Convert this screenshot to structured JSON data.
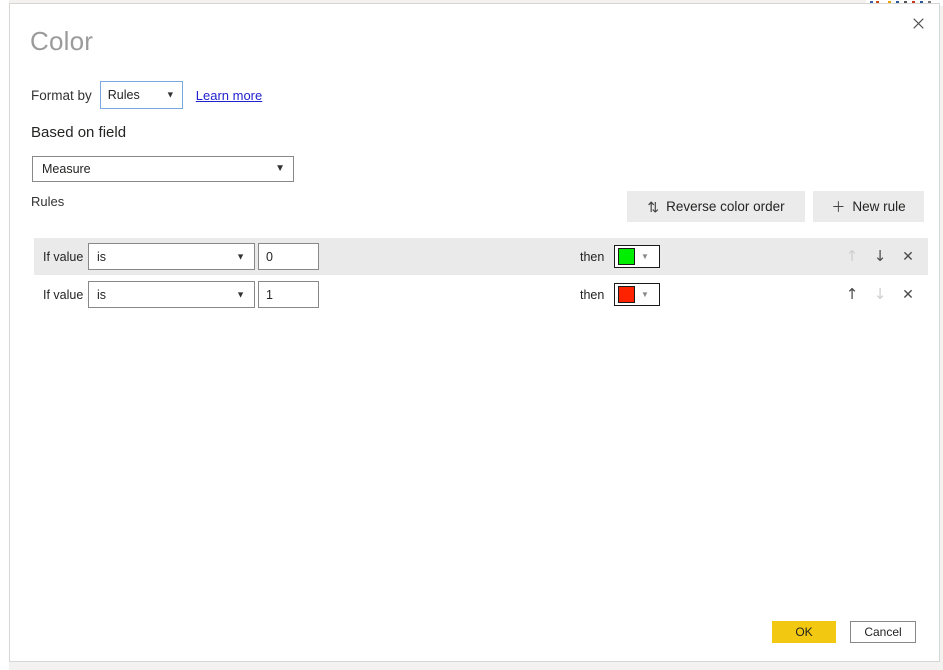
{
  "dialog": {
    "title": "Color",
    "close_icon": "close-icon"
  },
  "format_by": {
    "label": "Format by",
    "value": "Rules",
    "caret_icon": "chevron-down-icon",
    "learn_more": "Learn more"
  },
  "based_on_field": {
    "label": "Based on field",
    "value": "Measure",
    "caret_icon": "chevron-down-icon"
  },
  "rules_section": {
    "label": "Rules",
    "reverse_color_order": {
      "label": "Reverse color order",
      "icon": "sort-arrows-icon",
      "glyph": "⇅"
    },
    "new_rule": {
      "label": "New rule",
      "icon": "plus-icon",
      "glyph": "＋"
    },
    "column_labels": {
      "if_value": "If value",
      "then": "then"
    },
    "row_actions": {
      "move_up_icon": "arrow-up-icon",
      "move_up_glyph": "↑",
      "move_down_icon": "arrow-down-icon",
      "move_down_glyph": "↓",
      "remove_icon": "close-icon",
      "remove_glyph": "✕"
    },
    "rules": [
      {
        "if_value_label": "If value",
        "condition": "is",
        "value": "0",
        "then_label": "then",
        "color": "#00ee00",
        "move_up_enabled": false,
        "move_down_enabled": true,
        "highlighted": true
      },
      {
        "if_value_label": "If value",
        "condition": "is",
        "value": "1",
        "then_label": "then",
        "color": "#fd2200",
        "move_up_enabled": true,
        "move_down_enabled": false,
        "highlighted": false
      }
    ]
  },
  "footer": {
    "ok_label": "OK",
    "cancel_label": "Cancel"
  },
  "theme": {
    "accent": "#f2c811",
    "link": "#2121cf",
    "row_highlight": "#eaeaea",
    "toolbar_button_bg": "#ebebeb"
  }
}
